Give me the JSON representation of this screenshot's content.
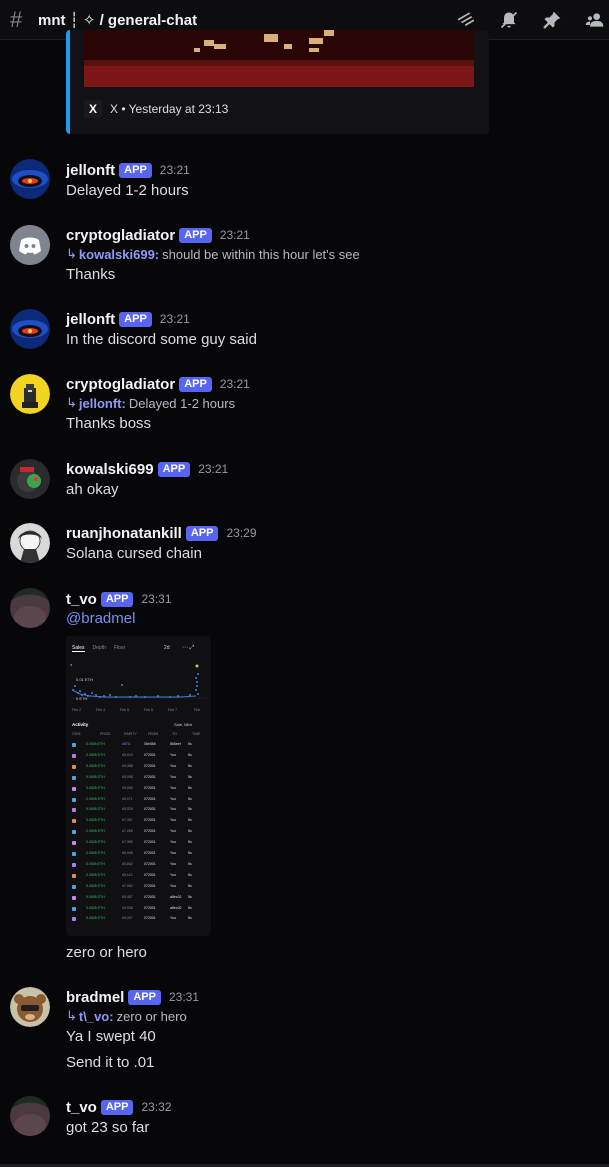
{
  "header": {
    "channel": "mnt ┆ ✧ / general-chat",
    "icons": [
      "threads-icon",
      "mute-bell-icon",
      "pin-icon",
      "members-icon"
    ]
  },
  "embed": {
    "source": "X",
    "footer": "X • Yesterday at 23:13"
  },
  "messages": [
    {
      "user": "jellonft",
      "tag": "APP",
      "time": "23:21",
      "text": "Delayed 1-2 hours"
    },
    {
      "user": "cryptogladiator",
      "tag": "APP",
      "time": "23:21",
      "reply_user": "kowalski699:",
      "reply_text": "should be within this hour let's see",
      "text": "Thanks"
    },
    {
      "user": "jellonft",
      "tag": "APP",
      "time": "23:21",
      "text": "In the discord some guy said"
    },
    {
      "user": "cryptogladiator",
      "tag": "APP",
      "time": "23:21",
      "reply_user": "jellonft:",
      "reply_text": "Delayed 1-2 hours",
      "text": "Thanks boss"
    },
    {
      "user": "kowalski699",
      "tag": "APP",
      "time": "23:21",
      "text": "ah okay"
    },
    {
      "user": "ruanjhonatankill",
      "tag": "APP",
      "time": "23:29",
      "text": "Solana cursed chain"
    },
    {
      "user": "t_vo",
      "tag": "APP",
      "time": "23:31",
      "text": "@bradmel",
      "text2": "zero or hero"
    },
    {
      "user": "bradmel",
      "tag": "APP",
      "time": "23:31",
      "reply_user": "t\\_vo:",
      "reply_text": "zero or hero",
      "text": "Ya I swept 40",
      "text2": "Send it to .01"
    },
    {
      "user": "t_vo",
      "tag": "APP",
      "time": "23:32",
      "text": "got 23 so far"
    }
  ],
  "attachment": {
    "tabs": [
      "Sales",
      "Depth",
      "Floor"
    ],
    "range": "2d",
    "heading": "Activity",
    "filter": "Sale, Mint",
    "chart_labels": [
      "0.01 ETH",
      "0 ETH"
    ],
    "x_labels": [
      "Feb 2",
      "Feb 4",
      "Feb 5",
      "Feb 6",
      "Feb 7",
      "Feb"
    ],
    "columns": [
      "ITEM",
      "PRICE",
      "RARITY",
      "FROM",
      "TO",
      "TIME"
    ],
    "rows": [
      {
        "price": "0.0005 ETH",
        "rarity": "#574",
        "from": "06e566",
        "to": "868eef",
        "time": "5s"
      },
      {
        "price": "0.0005 ETH",
        "rarity": "#5,029",
        "from": "072001",
        "to": "You",
        "time": "5s"
      },
      {
        "price": "0.0005 ETH",
        "rarity": "#5,388",
        "from": "072001",
        "to": "You",
        "time": "5s"
      },
      {
        "price": "0.0005 ETH",
        "rarity": "#5,098",
        "from": "072001",
        "to": "You",
        "time": "5s"
      },
      {
        "price": "0.0005 ETH",
        "rarity": "#5,059",
        "from": "072001",
        "to": "You",
        "time": "5s"
      },
      {
        "price": "0.0005 ETH",
        "rarity": "#5,071",
        "from": "072001",
        "to": "You",
        "time": "5s"
      },
      {
        "price": "0.0005 ETH",
        "rarity": "#5,029",
        "from": "072001",
        "to": "You",
        "time": "5s"
      },
      {
        "price": "0.0005 ETH",
        "rarity": "#7,367",
        "from": "072001",
        "to": "You",
        "time": "5s"
      },
      {
        "price": "0.0005 ETH",
        "rarity": "#7,285",
        "from": "072001",
        "to": "You",
        "time": "5s"
      },
      {
        "price": "0.0005 ETH",
        "rarity": "#7,389",
        "from": "072001",
        "to": "You",
        "time": "5s"
      },
      {
        "price": "0.0005 ETH",
        "rarity": "#5,998",
        "from": "072001",
        "to": "You",
        "time": "5s"
      },
      {
        "price": "0.0005 ETH",
        "rarity": "#5,842",
        "from": "072001",
        "to": "You",
        "time": "5s"
      },
      {
        "price": "0.0005 ETH",
        "rarity": "#5,113",
        "from": "072001",
        "to": "You",
        "time": "5s"
      },
      {
        "price": "0.0005 ETH",
        "rarity": "#7,082",
        "from": "072001",
        "to": "You",
        "time": "5s"
      },
      {
        "price": "0.0005 ETH",
        "rarity": "#5,487",
        "from": "072001",
        "to": "a8ec02",
        "time": "5s"
      },
      {
        "price": "0.0005 ETH",
        "rarity": "#5,938",
        "from": "072001",
        "to": "a8ec02",
        "time": "5s"
      },
      {
        "price": "0.0005 ETH",
        "rarity": "#5,337",
        "from": "072001",
        "to": "You",
        "time": "5s"
      }
    ]
  },
  "colors": {
    "app_tag": "#5865f2",
    "mention": "#7e8df5",
    "embed_accent": "#1d9bf0",
    "background": "#070709"
  }
}
